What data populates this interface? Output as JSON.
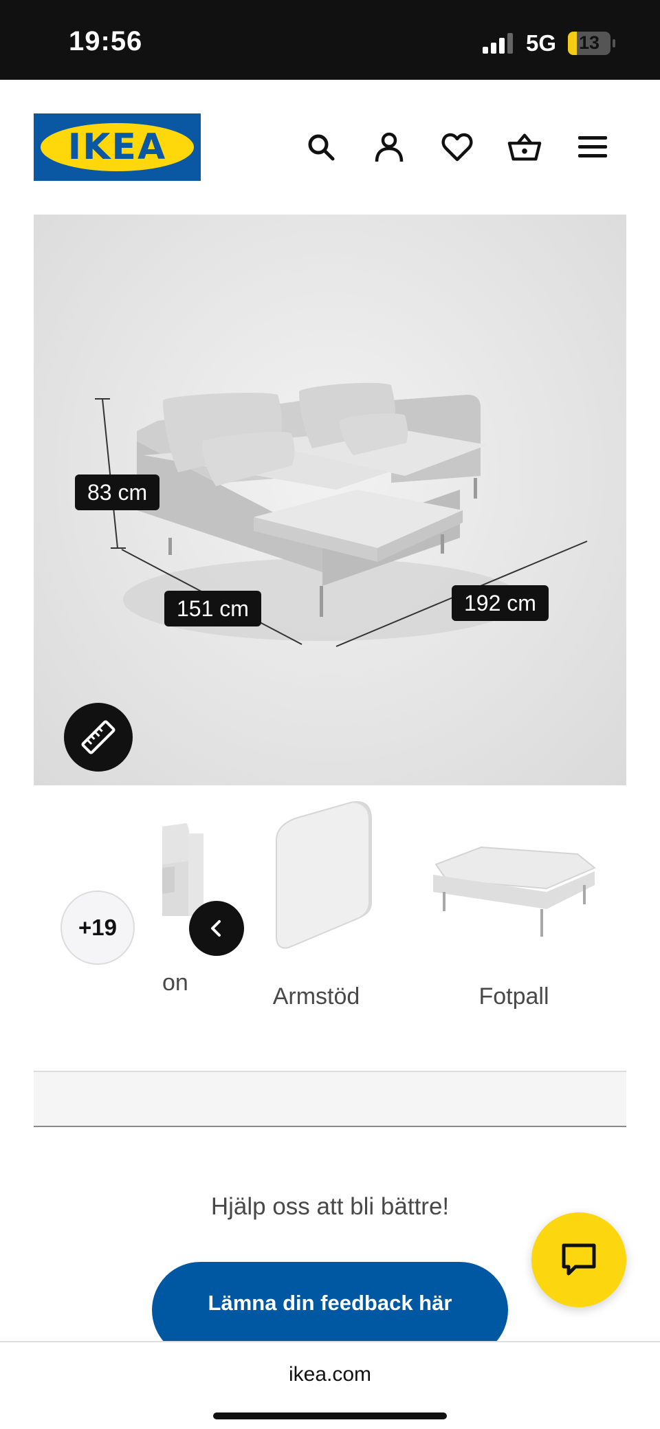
{
  "status_bar": {
    "time": "19:56",
    "network": "5G",
    "battery_level": "13"
  },
  "header": {
    "logo_text": "IKEA",
    "brand_colors": {
      "blue": "#0058a3",
      "yellow": "#fbd914"
    },
    "icons": [
      "search-icon",
      "account-icon",
      "heart-icon",
      "basket-icon",
      "menu-icon"
    ]
  },
  "product_image": {
    "dimensions": {
      "height": "83 cm",
      "depth": "151 cm",
      "width": "192 cm"
    },
    "measure_icon": "ruler-icon"
  },
  "thumbnails": {
    "more_count": "+19",
    "items": [
      {
        "label": "on"
      },
      {
        "label": "Armstöd"
      },
      {
        "label": "Fotpall"
      }
    ]
  },
  "feedback": {
    "prompt": "Hjälp oss att bli bättre!",
    "button_label": "Lämna din feedback här"
  },
  "browser": {
    "url": "ikea.com"
  }
}
